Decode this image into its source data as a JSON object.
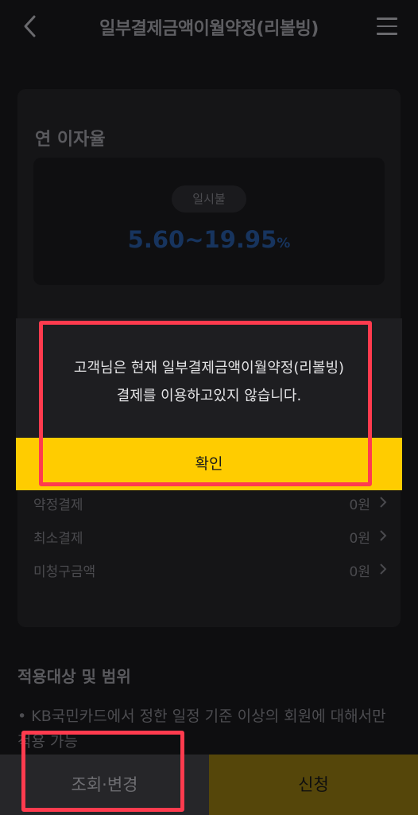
{
  "header": {
    "title": "일부결제금액이월약정(리볼빙)",
    "back_icon": "back-arrow-icon",
    "menu_icon": "hamburger-menu-icon"
  },
  "rate": {
    "section_title": "연 이자율",
    "type_label": "일시불",
    "value": "5.60~19.95",
    "unit": "%"
  },
  "rows": [
    {
      "label": "약정결제",
      "amount": "0원"
    },
    {
      "label": "최소결제",
      "amount": "0원"
    },
    {
      "label": "미청구금액",
      "amount": "0원"
    }
  ],
  "scope": {
    "title": "적용대상 및 범위",
    "bullet_marker": "•",
    "bullet_text": "KB국민카드에서 정한 일정 기준 이상의 회원에 대해서만 적용 가능"
  },
  "dialog": {
    "line1": "고객님은 현재 일부결제금액이월약정(리볼빙)",
    "line2": "결제를 이용하고있지 않습니다.",
    "confirm_label": "확인"
  },
  "bottom": {
    "left_label": "조회·변경",
    "right_label": "신청"
  },
  "colors": {
    "accent_yellow": "#ffcc00",
    "rate_blue": "#17345e",
    "annotation_red": "#ff3b4e"
  }
}
